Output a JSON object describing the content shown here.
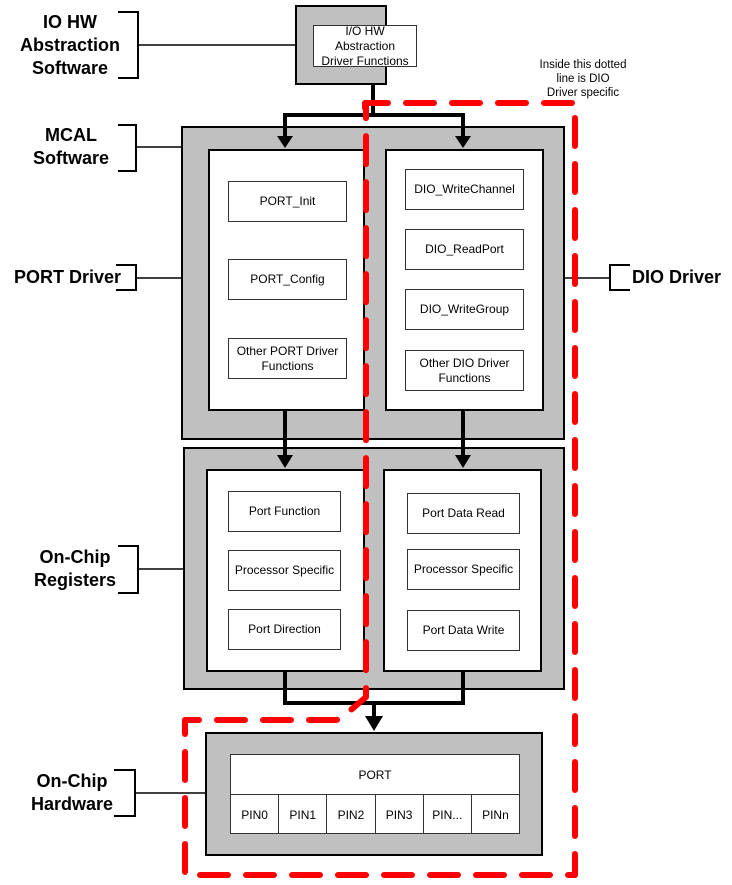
{
  "layers": {
    "io_hw": "IO HW\nAbstraction\nSoftware",
    "mcal": "MCAL\nSoftware",
    "port_driver": "PORT Driver",
    "dio_driver": "DIO Driver",
    "registers": "On-Chip\nRegisters",
    "hardware": "On-Chip\nHardware"
  },
  "io_hw_box": {
    "label": "I/O HW Abstraction\nDriver Functions"
  },
  "note": "Inside this dotted\nline is DIO\nDriver specific",
  "port_driver_functions": [
    "PORT_Init",
    "PORT_Config",
    "Other PORT Driver\nFunctions"
  ],
  "dio_driver_functions": [
    "DIO_WriteChannel",
    "DIO_ReadPort",
    "DIO_WriteGroup",
    "Other  DIO Driver\nFunctions"
  ],
  "port_registers": [
    "Port Function",
    "Processor Specific",
    "Port Direction"
  ],
  "dio_registers": [
    "Port Data Read",
    "Processor Specific",
    "Port Data Write"
  ],
  "port": {
    "label": "PORT",
    "pins": [
      "PIN0",
      "PIN1",
      "PIN2",
      "PIN3",
      "PIN...",
      "PINn"
    ]
  },
  "colors": {
    "block_fill": "#c0c0c0",
    "dio_boundary": "#ff0000"
  }
}
